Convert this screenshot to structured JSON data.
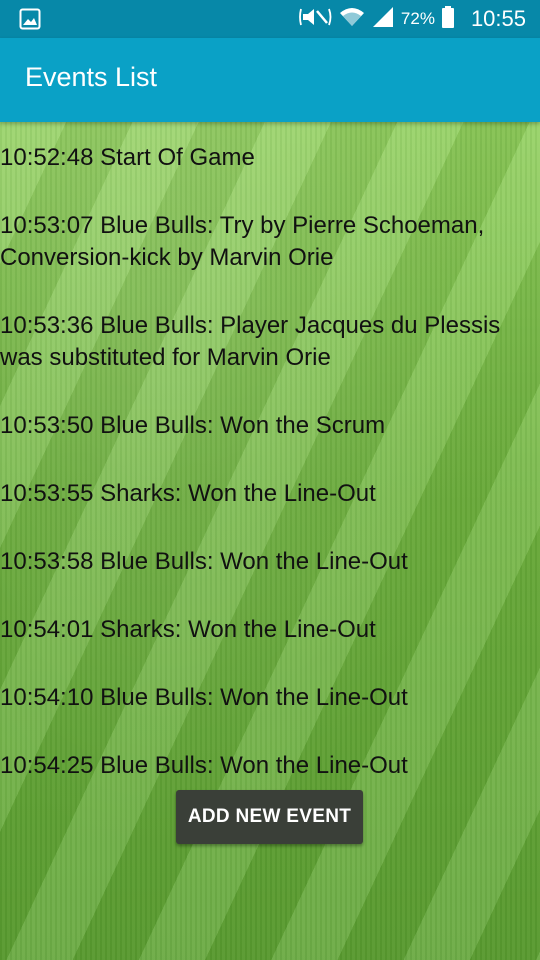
{
  "status_bar": {
    "battery": "72%",
    "time": "10:55",
    "icons": [
      "image-icon",
      "mute-icon",
      "wifi-icon",
      "signal-icon",
      "battery-icon"
    ]
  },
  "app_bar": {
    "title": "Events List",
    "color": "#0aa1c6"
  },
  "events": [
    "10:52:48 Start Of Game",
    "10:53:07 Blue Bulls: Try by Pierre Schoeman, Conversion-kick by Marvin Orie",
    "10:53:36 Blue Bulls: Player Jacques du Plessis was substituted for Marvin Orie",
    "10:53:50 Blue Bulls: Won the Scrum",
    "10:53:55 Sharks: Won the Line-Out",
    "10:53:58 Blue Bulls: Won the Line-Out",
    "10:54:01 Sharks: Won the Line-Out",
    "10:54:10 Blue Bulls: Won the Line-Out",
    "10:54:25 Blue Bulls: Won the Line-Out"
  ],
  "add_button": {
    "label": "ADD NEW EVENT"
  }
}
